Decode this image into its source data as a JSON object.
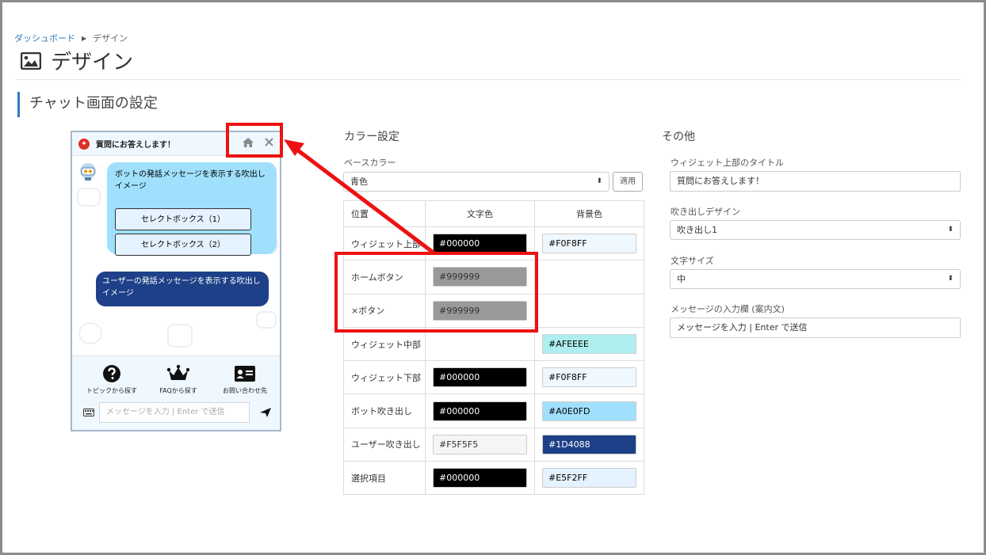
{
  "breadcrumb": {
    "home": "ダッシュボード",
    "current": "デザイン"
  },
  "page": {
    "title": "デザイン",
    "section_title": "チャット画面の設定"
  },
  "widget": {
    "title": "質問にお答えします！",
    "bot_message": "ボットの発話メッセージを表示する吹出しイメージ",
    "options": [
      "セレクトボックス（1）",
      "セレクトボックス（2）"
    ],
    "user_message": "ユーザーの発話メッセージを表示する吹出しイメージ",
    "nav": [
      {
        "label": "トピックから探す",
        "icon": "question-circle-icon"
      },
      {
        "label": "FAQから探す",
        "icon": "crown-icon"
      },
      {
        "label": "お問い合わせ先",
        "icon": "contact-card-icon"
      }
    ],
    "input_placeholder": "メッセージを入力 | Enter で送信"
  },
  "color_settings": {
    "heading": "カラー設定",
    "base_color_label": "ベースカラー",
    "base_color_value": "青色",
    "apply_label": "適用",
    "columns": [
      "位置",
      "文字色",
      "背景色"
    ],
    "rows": [
      {
        "position": "ウィジェット上部",
        "fg": "#000000",
        "bg": "#F0F8FF"
      },
      {
        "position": "ホームボタン",
        "fg": "#999999",
        "bg": ""
      },
      {
        "position": "×ボタン",
        "fg": "#999999",
        "bg": ""
      },
      {
        "position": "ウィジェット中部",
        "fg": "",
        "bg": "#AFEEEE"
      },
      {
        "position": "ウィジェット下部",
        "fg": "#000000",
        "bg": "#F0F8FF"
      },
      {
        "position": "ボット吹き出し",
        "fg": "#000000",
        "bg": "#A0E0FD"
      },
      {
        "position": "ユーザー吹き出し",
        "fg": "#F5F5F5",
        "bg": "#1D4088"
      },
      {
        "position": "選択項目",
        "fg": "#000000",
        "bg": "#E5F2FF"
      }
    ]
  },
  "other": {
    "heading": "その他",
    "widget_title_label": "ウィジェット上部のタイトル",
    "widget_title_value": "質問にお答えします！",
    "bubble_design_label": "吹き出しデザイン",
    "bubble_design_value": "吹き出し1",
    "font_size_label": "文字サイズ",
    "font_size_value": "中",
    "input_placeholder_label": "メッセージの入力欄 (案内文)",
    "input_placeholder_value": "メッセージを入力 | Enter で送信"
  },
  "colors": {
    "accent": "#2b7bc0",
    "annotation": "#ee1111",
    "widget_header_bg": "#F0F8FF",
    "bot_bubble": "#A0E0FD",
    "user_bubble": "#1D4088",
    "option_bg": "#E5F2FF"
  }
}
